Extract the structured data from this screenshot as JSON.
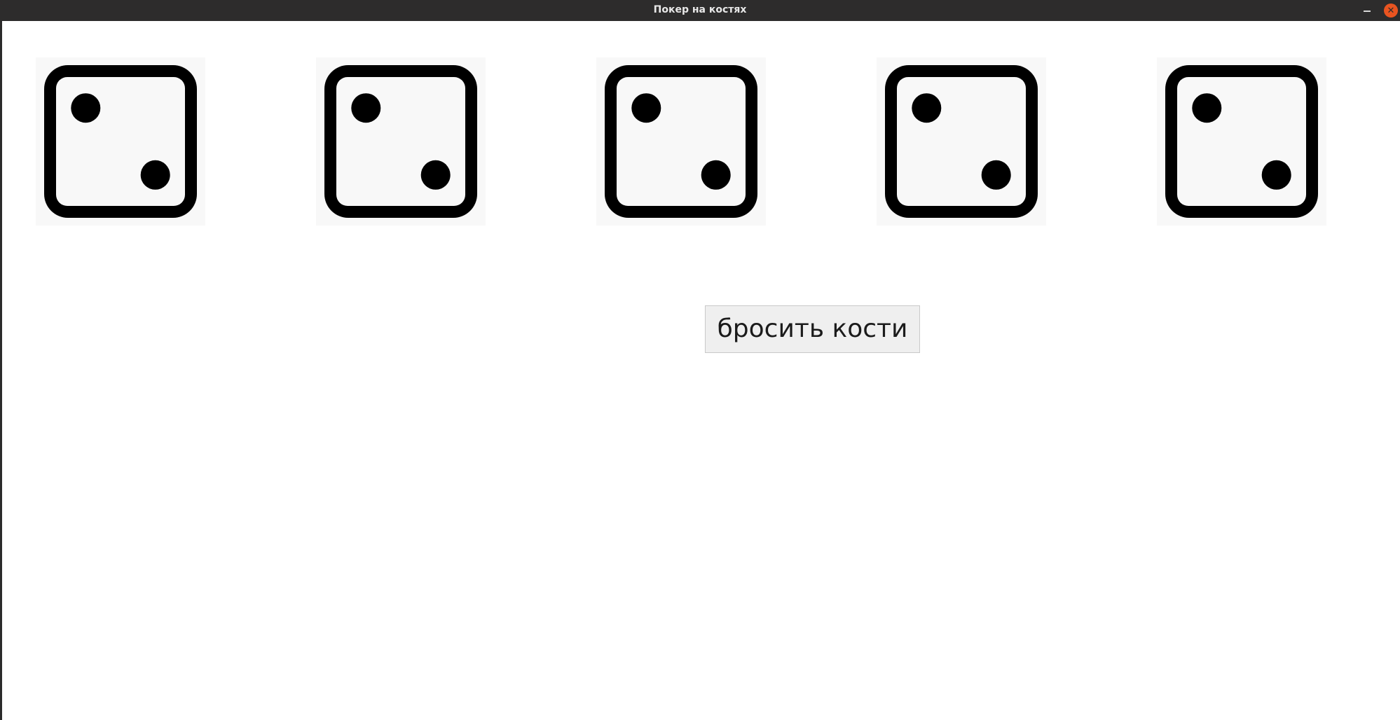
{
  "window": {
    "title": "Покер на костях",
    "minimize_icon": "minimize-icon",
    "close_icon": "close-icon",
    "close_color": "#e95420"
  },
  "dice": [
    {
      "value": 2
    },
    {
      "value": 2
    },
    {
      "value": 2
    },
    {
      "value": 2
    },
    {
      "value": 2
    }
  ],
  "roll_button": {
    "label": "бросить кости"
  }
}
